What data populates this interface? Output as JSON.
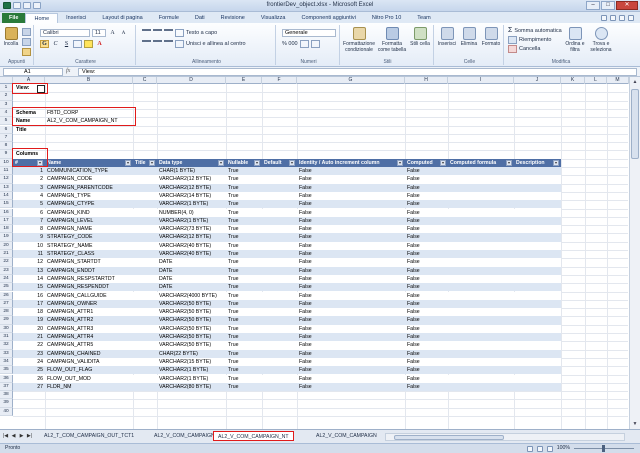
{
  "window": {
    "title": "frontierDev_object.xlsx - Microsoft Excel",
    "minimize": "–",
    "maximize": "□",
    "close": "✕"
  },
  "ribbon_tabs": [
    "File",
    "Home",
    "Inserisci",
    "Layout di pagina",
    "Formule",
    "Dati",
    "Revisione",
    "Visualizza",
    "Componenti aggiuntivi",
    "Nitro Pro 10",
    "Team"
  ],
  "ribbon": {
    "paste_label": "Incolla",
    "clipboard_group": "Appunti",
    "font_name": "Calibri",
    "font_size": "11",
    "font_group": "Carattere",
    "wrap_text": "Testo a capo",
    "merge_center": "Unisci e allinea al centro",
    "alignment_group": "Allineamento",
    "number_format": "Generale",
    "number_symbols": "% 000",
    "number_group": "Numeri",
    "conditional_format": "Formattazione condizionale",
    "format_as_table": "Formatta come tabella",
    "cell_styles": "Stili cella",
    "styles_group": "Stili",
    "insert": "Inserisci",
    "delete": "Elimina",
    "format": "Formato",
    "cells_group": "Celle",
    "autosum": "Somma automatica",
    "fill": "Riempimento",
    "clear": "Cancella",
    "sort_filter": "Ordina e filtra",
    "find_select": "Trova e seleziona",
    "editing_group": "Modifica"
  },
  "formula_bar": {
    "name_box": "A1",
    "fx": "fx",
    "content": "View:"
  },
  "columns": [
    "A",
    "B",
    "C",
    "D",
    "E",
    "F",
    "G",
    "H",
    "I",
    "J",
    "K",
    "L",
    "M"
  ],
  "rows": [
    1,
    2,
    3,
    4,
    5,
    6,
    7,
    8,
    9,
    10,
    11,
    12,
    13,
    14,
    15,
    16,
    17,
    18,
    19,
    20,
    21,
    22,
    23,
    24,
    25,
    26,
    27,
    28,
    29,
    30,
    31,
    32,
    33,
    34,
    35,
    36,
    37,
    38,
    39,
    40
  ],
  "sheet": {
    "view_label": "View:",
    "schema_label": "Schema",
    "schema_value": "FBTD_CORP",
    "name_label": "Name",
    "name_value": "AL2_V_COM_CAMPAIGN_NT",
    "title_label": "Title",
    "columns_label": "Columns",
    "table_headers": [
      "#",
      "Name",
      "Title",
      "Data type",
      "Nullable",
      "Default",
      "Identity / Auto increment column",
      "Computed",
      "Computed formula",
      "Description"
    ],
    "table_rows": [
      [
        "1",
        "COMMUNICATION_TYPE",
        "CHAR(1 BYTE)",
        "True",
        "False",
        "False"
      ],
      [
        "2",
        "CAMPAIGN_CODE",
        "VARCHAR2(12 BYTE)",
        "True",
        "False",
        "False"
      ],
      [
        "3",
        "CAMPAIGN_PARENTCODE",
        "VARCHAR2(12 BYTE)",
        "True",
        "False",
        "False"
      ],
      [
        "4",
        "CAMPAIGN_TYPE",
        "VARCHAR2(14 BYTE)",
        "True",
        "False",
        "False"
      ],
      [
        "5",
        "CAMPAIGN_CTYPE",
        "VARCHAR2(1 BYTE)",
        "True",
        "False",
        "False"
      ],
      [
        "6",
        "CAMPAIGN_KIND",
        "NUMBER(4, 0)",
        "True",
        "False",
        "False"
      ],
      [
        "7",
        "CAMPAIGN_LEVEL",
        "VARCHAR2(1 BYTE)",
        "True",
        "False",
        "False"
      ],
      [
        "8",
        "CAMPAIGN_NAME",
        "VARCHAR2(73 BYTE)",
        "True",
        "False",
        "False"
      ],
      [
        "9",
        "STRATEGY_CODE",
        "VARCHAR2(12 BYTE)",
        "True",
        "False",
        "False"
      ],
      [
        "10",
        "STRATEGY_NAME",
        "VARCHAR2(40 BYTE)",
        "True",
        "False",
        "False"
      ],
      [
        "11",
        "STRATEGY_CLASS",
        "VARCHAR2(40 BYTE)",
        "True",
        "False",
        "False"
      ],
      [
        "12",
        "CAMPAIGN_STARTDT",
        "DATE",
        "True",
        "False",
        "False"
      ],
      [
        "13",
        "CAMPAIGN_ENDDT",
        "DATE",
        "True",
        "False",
        "False"
      ],
      [
        "14",
        "CAMPAIGN_RESPSTARTDT",
        "DATE",
        "True",
        "False",
        "False"
      ],
      [
        "15",
        "CAMPAIGN_RESPENDDT",
        "DATE",
        "True",
        "False",
        "False"
      ],
      [
        "16",
        "CAMPAIGN_CALLGUIDE",
        "VARCHAR2(4000 BYTE)",
        "True",
        "False",
        "False"
      ],
      [
        "17",
        "CAMPAIGN_OWNER",
        "VARCHAR2(50 BYTE)",
        "True",
        "False",
        "False"
      ],
      [
        "18",
        "CAMPAIGN_ATTR1",
        "VARCHAR2(50 BYTE)",
        "True",
        "False",
        "False"
      ],
      [
        "19",
        "CAMPAIGN_ATTR2",
        "VARCHAR2(50 BYTE)",
        "True",
        "False",
        "False"
      ],
      [
        "20",
        "CAMPAIGN_ATTR3",
        "VARCHAR2(50 BYTE)",
        "True",
        "False",
        "False"
      ],
      [
        "21",
        "CAMPAIGN_ATTR4",
        "VARCHAR2(50 BYTE)",
        "True",
        "False",
        "False"
      ],
      [
        "22",
        "CAMPAIGN_ATTR5",
        "VARCHAR2(50 BYTE)",
        "True",
        "False",
        "False"
      ],
      [
        "23",
        "CAMPAIGN_CHAINED",
        "CHAR(22 BYTE)",
        "True",
        "False",
        "False"
      ],
      [
        "24",
        "CAMPAIGN_VALIDITA",
        "VARCHAR2(15 BYTE)",
        "True",
        "False",
        "False"
      ],
      [
        "25",
        "FLOW_OUT_FLAG",
        "VARCHAR2(1 BYTE)",
        "True",
        "False",
        "False"
      ],
      [
        "26",
        "FLOW_OUT_MOD",
        "VARCHAR2(1 BYTE)",
        "True",
        "False",
        "False"
      ],
      [
        "27",
        "FLDR_NM",
        "VARCHAR2(80 BYTE)",
        "True",
        "False",
        "False"
      ]
    ]
  },
  "sheet_tabs": [
    "AL2_T_COM_CAMPAIGN_OUT_TCT1",
    "AL2_V_COM_CAMPAIGN",
    "AL2_V_COM_CAMPAIGN_NT",
    "AL2_V_COM_CAMPAIGN"
  ],
  "active_sheet_index": 2,
  "status": {
    "ready": "Pronto",
    "zoom": "100%"
  },
  "colors": {
    "table_header": "#4f6fa5",
    "band": "#dce6f3",
    "highlight": "#e01b1b",
    "file_tab": "#2a7a3a"
  }
}
